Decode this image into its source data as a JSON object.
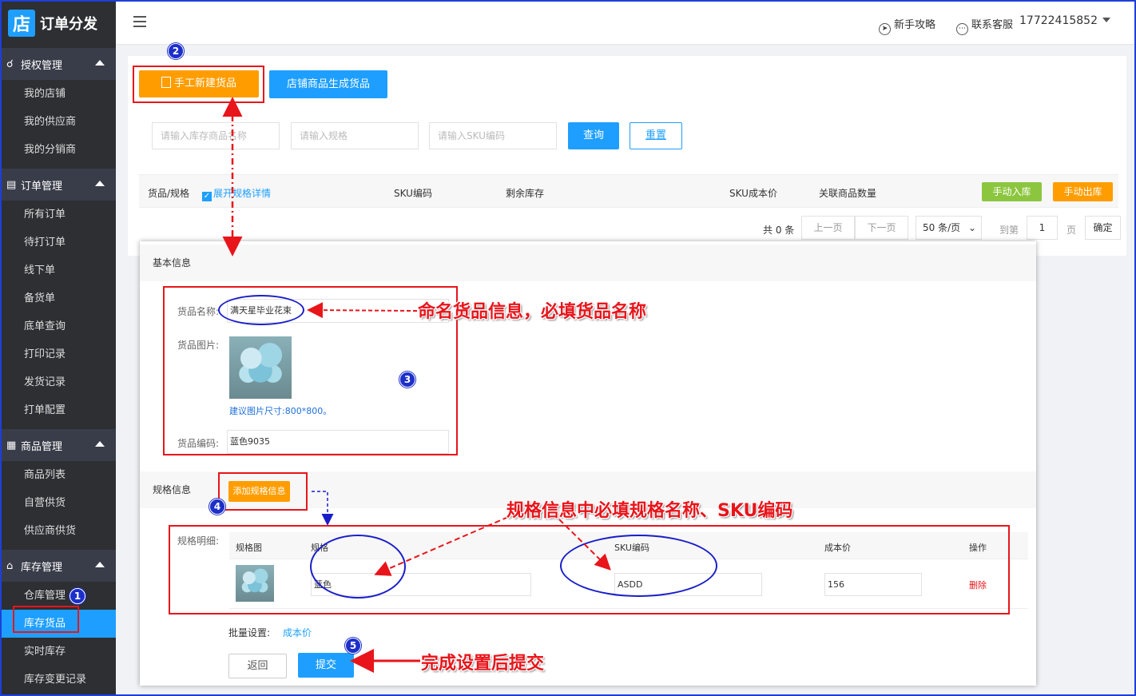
{
  "app": {
    "logo_char": "店",
    "title": "订单分发"
  },
  "sidebar": {
    "groups": [
      {
        "label": "授权管理",
        "items": [
          "我的店铺",
          "我的供应商",
          "我的分销商"
        ]
      },
      {
        "label": "订单管理",
        "items": [
          "所有订单",
          "待打订单",
          "线下单",
          "备货单",
          "底单查询",
          "打印记录",
          "发货记录",
          "打单配置"
        ]
      },
      {
        "label": "商品管理",
        "items": [
          "商品列表",
          "自营供货",
          "供应商供货"
        ]
      },
      {
        "label": "库存管理",
        "items": [
          "仓库管理",
          "库存货品",
          "实时库存",
          "库存变更记录"
        ]
      }
    ],
    "active_item": "库存货品"
  },
  "header": {
    "guide": "新手攻略",
    "contact": "联系客服",
    "user": "17722415852"
  },
  "toolbar": {
    "manual_create": "手工新建货品",
    "shop_generate": "店铺商品生成货品"
  },
  "search": {
    "name_placeholder": "请输入库存商品名称",
    "spec_placeholder": "请输入规格",
    "sku_placeholder": "请输入SKU编码",
    "query": "查询",
    "reset": "重置"
  },
  "table": {
    "col_goods": "货品/规格",
    "expand_label": "展开规格详情",
    "col_sku": "SKU编码",
    "col_stock": "剩余库存",
    "col_cost": "SKU成本价",
    "col_linked": "关联商品数量",
    "btn_in": "手动入库",
    "btn_out": "手动出库"
  },
  "pagination": {
    "total": "共 0 条",
    "prev": "上一页",
    "next": "下一页",
    "per_page": "50 条/页",
    "goto": "到第",
    "page_value": "1",
    "page_unit": "页",
    "confirm": "确定"
  },
  "form": {
    "basic_title": "基本信息",
    "name_label": "货品名称:",
    "name_value": "满天星毕业花束",
    "image_label": "货品图片:",
    "image_hint": "建议图片尺寸:800*800。",
    "code_label": "货品编码:",
    "code_value": "蓝色9035",
    "spec_title": "规格信息",
    "add_spec": "添加规格信息",
    "detail_label": "规格明细:",
    "col_img": "规格图",
    "col_spec": "规格",
    "col_sku": "SKU编码",
    "col_cost": "成本价",
    "col_op": "操作",
    "row_spec": "蓝色",
    "row_sku": "ASDD",
    "row_cost": "156",
    "row_delete": "删除",
    "batch_label": "批量设置:",
    "batch_link": "成本价",
    "back": "返回",
    "submit": "提交"
  },
  "annotations": {
    "a1": "命名货品信息，必填货品名称",
    "a2": "规格信息中必填规格名称、SKU编码",
    "a3": "完成设置后提交",
    "n1": "1",
    "n2": "2",
    "n3": "3",
    "n4": "4",
    "n5": "5"
  },
  "colors": {
    "accent_blue": "#1e9fff",
    "accent_orange": "#ff9d00",
    "sidebar_bg": "#2d2f33",
    "annotation_red": "#e8151b",
    "annotation_blue": "#1a1ec9",
    "green_btn": "#8cc63f"
  }
}
